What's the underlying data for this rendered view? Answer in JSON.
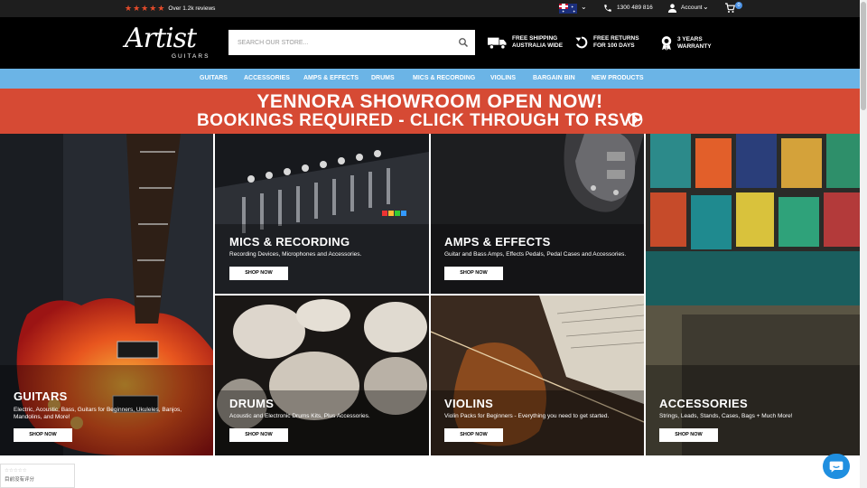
{
  "topbar": {
    "rating_text": "Over 1.2k reviews",
    "star_count": 5,
    "phone": "1300 489 816",
    "account_label": "Account",
    "cart_count": "0"
  },
  "header": {
    "logo_script": "Artist",
    "logo_sub": "GUITARS",
    "search_placeholder": "SEARCH OUR STORE...",
    "features": [
      {
        "line1": "FREE SHIPPING",
        "line2": "AUSTRALIA WIDE",
        "icon": "truck-icon"
      },
      {
        "line1": "FREE RETURNS",
        "line2": "FOR 100 DAYS",
        "icon": "return-arrow-icon"
      },
      {
        "line1": "3 YEARS",
        "line2": "WARRANTY",
        "icon": "warranty-badge-icon"
      }
    ]
  },
  "nav": {
    "items": [
      "GUITARS",
      "ACCESSORIES",
      "AMPS & EFFECTS",
      "DRUMS",
      "MICS & RECORDING",
      "VIOLINS",
      "BARGAIN BIN",
      "NEW PRODUCTS"
    ]
  },
  "banner": {
    "line1": "YENNORA SHOWROOM OPEN NOW!",
    "line2": "BOOKINGS REQUIRED - CLICK THROUGH TO RSVP"
  },
  "tiles": [
    {
      "title": "GUITARS",
      "desc1": "Electric, Acoustic, Bass, Guitars for Beginners, Ukuleles, Banjos,",
      "desc2": "Mandolins, and More!",
      "button": "SHOP NOW"
    },
    {
      "title": "MICS & RECORDING",
      "desc1": "Recording Devices, Microphones and Accessories.",
      "desc2": "",
      "button": "SHOP NOW"
    },
    {
      "title": "AMPS & EFFECTS",
      "desc1": "Guitar and Bass Amps, Effects Pedals, Pedal Cases and Accessories.",
      "desc2": "",
      "button": "SHOP NOW"
    },
    {
      "title": "DRUMS",
      "desc1": "Acoustic and Electronic Drums Kits, Plus Accessories.",
      "desc2": "",
      "button": "SHOP NOW"
    },
    {
      "title": "VIOLINS",
      "desc1": "Violin Packs for Beginners - Everything you need to get started.",
      "desc2": "",
      "button": "SHOP NOW"
    },
    {
      "title": "ACCESSORIES",
      "desc1": "Strings, Leads, Stands, Cases, Bags + Much More!",
      "desc2": "",
      "button": "SHOP NOW"
    }
  ],
  "widgets": {
    "rating_stars": "☆☆☆☆☆",
    "rating_text": "目前没有评分"
  },
  "colors": {
    "topbar": "#1e1e1e",
    "header": "#000000",
    "nav": "#6bb4e6",
    "banner": "#d64a34",
    "star": "#e54b2a",
    "chat": "#1f8fe0"
  }
}
